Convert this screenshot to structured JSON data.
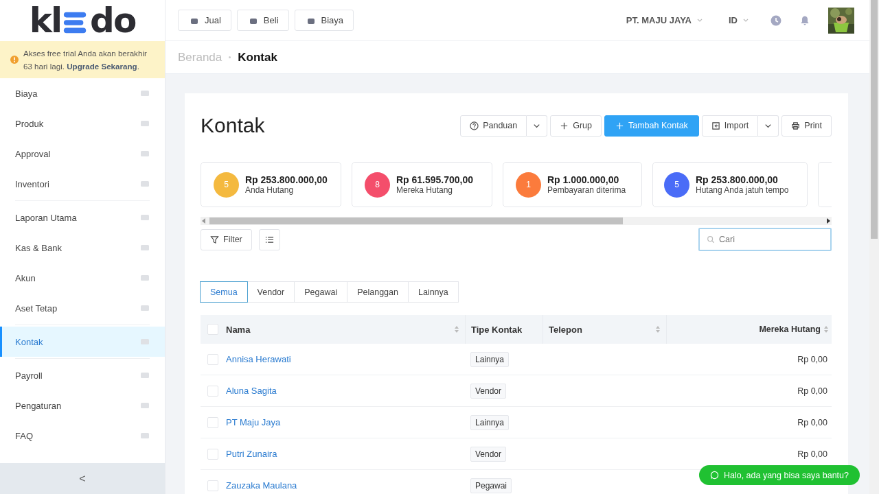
{
  "logo": {
    "before": "kl",
    "after": "do"
  },
  "trial_banner": {
    "text": "Akses free trial Anda akan berakhir 63 hari lagi. **Upgrade Sekarang**."
  },
  "sidebar": {
    "groups": [
      [
        {
          "label": "Biaya",
          "selected": false
        },
        {
          "label": "Produk",
          "selected": false
        },
        {
          "label": "Approval",
          "selected": false
        },
        {
          "label": "Inventori",
          "selected": false
        }
      ],
      [
        {
          "label": "Laporan Utama",
          "selected": false
        },
        {
          "label": "Kas & Bank",
          "selected": false
        },
        {
          "label": "Akun",
          "selected": false
        },
        {
          "label": "Aset Tetap",
          "selected": false
        }
      ],
      [
        {
          "label": "Kontak",
          "selected": true
        }
      ],
      [
        {
          "label": "Payroll",
          "selected": false
        },
        {
          "label": "Pengaturan",
          "selected": false
        },
        {
          "label": "FAQ",
          "selected": false
        }
      ]
    ],
    "collapse": "<"
  },
  "topbar": {
    "quick_buttons": [
      "Jual",
      "Beli",
      "Biaya"
    ],
    "company": "PT. MAJU JAYA",
    "language": "ID"
  },
  "breadcrumb": {
    "parent": "Beranda",
    "current": "Kontak"
  },
  "page_title": "Kontak",
  "actions": {
    "guide": "Panduan",
    "group": "Grup",
    "add": "Tambah Kontak",
    "import": "Import",
    "print": "Print"
  },
  "summary_cards": [
    {
      "count": "5",
      "amount": "Rp 253.800.000,00",
      "label": "Anda Hutang",
      "color": "#f4b93f"
    },
    {
      "count": "8",
      "amount": "Rp 61.595.700,00",
      "label": "Mereka Hutang",
      "color": "#f44e6b"
    },
    {
      "count": "1",
      "amount": "Rp 1.000.000,00",
      "label": "Pembayaran diterima",
      "color": "#fb7b3c"
    },
    {
      "count": "5",
      "amount": "Rp 253.800.000,00",
      "label": "Hutang Anda jatuh tempo",
      "color": "#4a6cf7"
    }
  ],
  "filter": {
    "label": "Filter"
  },
  "search": {
    "placeholder": "Cari"
  },
  "tabs": [
    {
      "label": "Semua",
      "selected": true
    },
    {
      "label": "Vendor",
      "selected": false
    },
    {
      "label": "Pegawai",
      "selected": false
    },
    {
      "label": "Pelanggan",
      "selected": false
    },
    {
      "label": "Lainnya",
      "selected": false
    }
  ],
  "table": {
    "select_all_checked": false,
    "columns": [
      {
        "label": "Nama",
        "sortable": true
      },
      {
        "label": "Tipe Kontak",
        "sortable": false
      },
      {
        "label": "Telepon",
        "sortable": true
      },
      {
        "label": "Mereka Hutang",
        "sortable": true
      }
    ],
    "rows": [
      {
        "checked": false,
        "name": "Annisa Herawati",
        "type": "Lainnya",
        "amount": "Rp 0,00"
      },
      {
        "checked": false,
        "name": "Aluna Sagita",
        "type": "Vendor",
        "amount": "Rp 0,00"
      },
      {
        "checked": false,
        "name": "PT Maju Jaya",
        "type": "Lainnya",
        "amount": "Rp 0,00"
      },
      {
        "checked": false,
        "name": "Putri Zunaira",
        "type": "Vendor",
        "amount": "Rp 0,00"
      },
      {
        "checked": false,
        "name": "Zauzaka Maulana",
        "type": "Pegawai"
      }
    ]
  },
  "chat_button": "Halo, ada yang bisa saya bantu?"
}
